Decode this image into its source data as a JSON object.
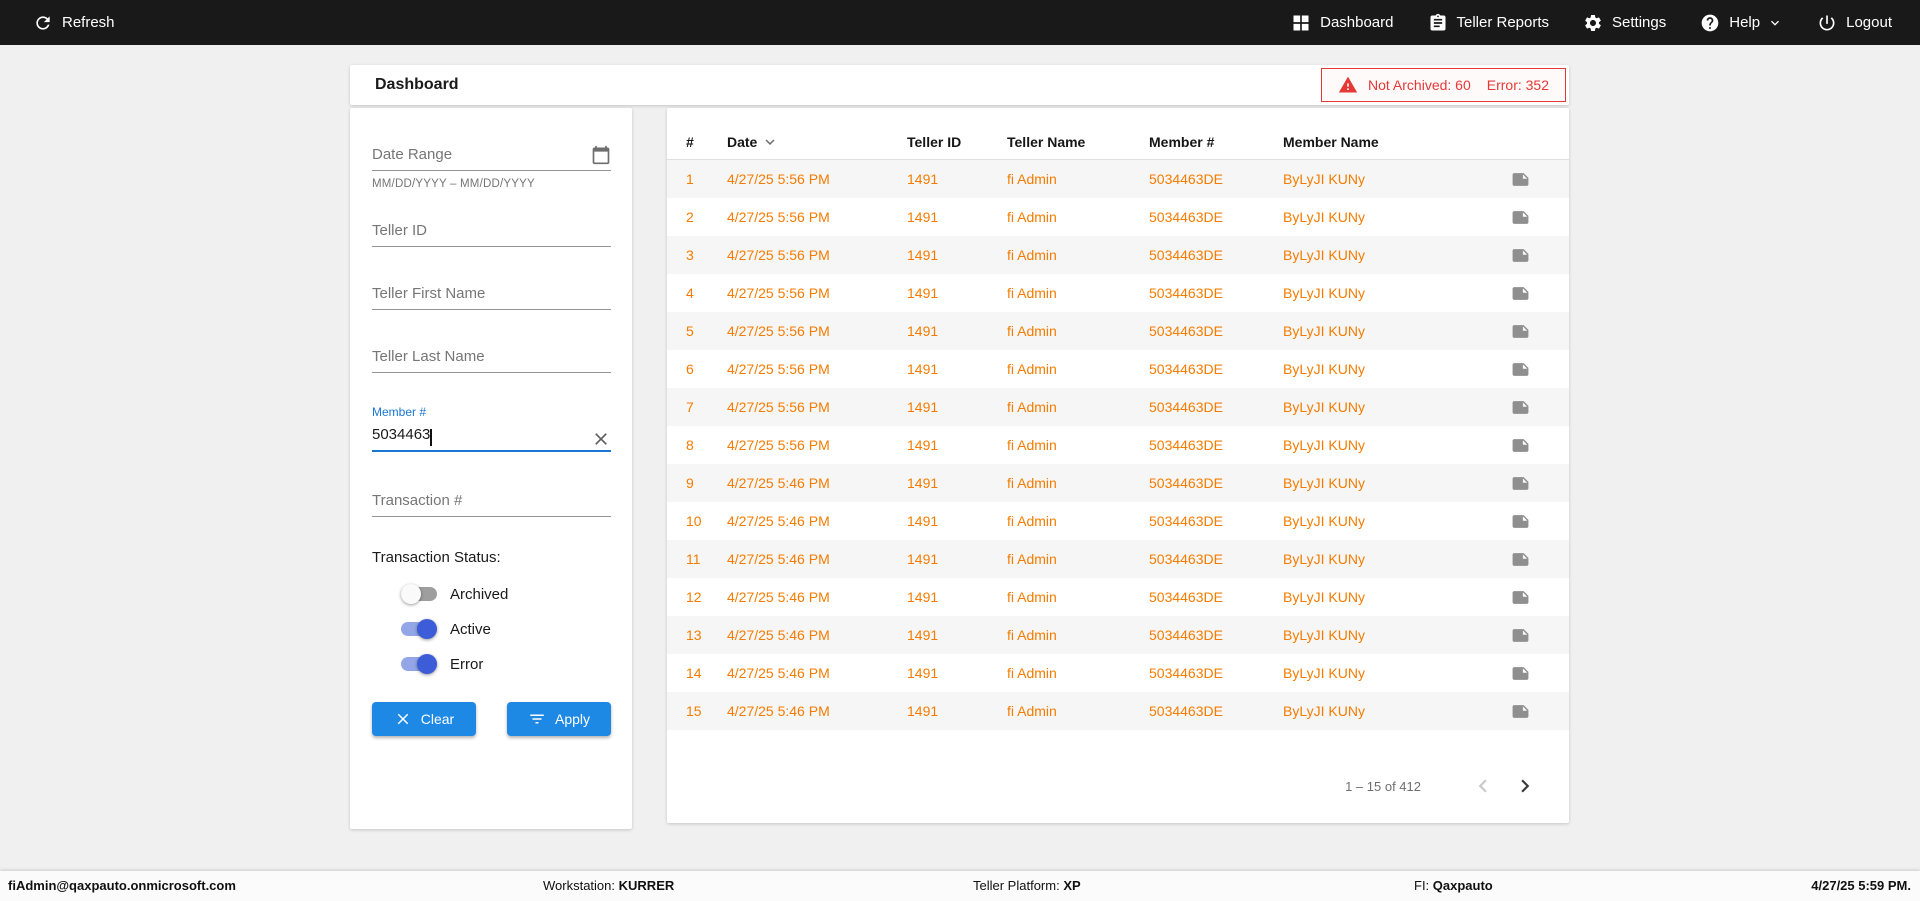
{
  "colors": {
    "accent_blue": "#1e88e5",
    "focus_blue": "#1976d2",
    "toggle_blue": "#3d5cd8",
    "row_orange": "#f57c00",
    "alert_red": "#e53935",
    "navbar_black": "#191919"
  },
  "navbar": {
    "refresh_label": "Refresh",
    "items": [
      {
        "label": "Dashboard",
        "icon": "dashboard-icon"
      },
      {
        "label": "Teller Reports",
        "icon": "reports-icon"
      },
      {
        "label": "Settings",
        "icon": "settings-icon"
      },
      {
        "label": "Help",
        "icon": "help-icon"
      },
      {
        "label": "Logout",
        "icon": "logout-icon"
      }
    ]
  },
  "header": {
    "title": "Dashboard",
    "alert": {
      "not_archived": "Not Archived: 60",
      "error": "Error: 352"
    }
  },
  "filters": {
    "date_range": {
      "placeholder": "Date Range",
      "hint": "MM/DD/YYYY – MM/DD/YYYY"
    },
    "teller_id_placeholder": "Teller ID",
    "teller_first_name_placeholder": "Teller First Name",
    "teller_last_name_placeholder": "Teller Last Name",
    "member_number": {
      "label": "Member #",
      "value": "5034463"
    },
    "transaction_number_placeholder": "Transaction #",
    "status_label": "Transaction Status:",
    "toggles": [
      {
        "label": "Archived",
        "on": false
      },
      {
        "label": "Active",
        "on": true
      },
      {
        "label": "Error",
        "on": true
      }
    ],
    "clear_label": "Clear",
    "apply_label": "Apply"
  },
  "table": {
    "columns": [
      "#",
      "Date",
      "Teller ID",
      "Teller Name",
      "Member #",
      "Member Name"
    ],
    "sorted_by": "Date",
    "rows": [
      {
        "num": "1",
        "date": "4/27/25 5:56 PM",
        "teller_id": "1491",
        "teller_name": "fi Admin",
        "member_number": "5034463DE",
        "member_name": "ByLyJI KUNy"
      },
      {
        "num": "2",
        "date": "4/27/25 5:56 PM",
        "teller_id": "1491",
        "teller_name": "fi Admin",
        "member_number": "5034463DE",
        "member_name": "ByLyJI KUNy"
      },
      {
        "num": "3",
        "date": "4/27/25 5:56 PM",
        "teller_id": "1491",
        "teller_name": "fi Admin",
        "member_number": "5034463DE",
        "member_name": "ByLyJI KUNy"
      },
      {
        "num": "4",
        "date": "4/27/25 5:56 PM",
        "teller_id": "1491",
        "teller_name": "fi Admin",
        "member_number": "5034463DE",
        "member_name": "ByLyJI KUNy"
      },
      {
        "num": "5",
        "date": "4/27/25 5:56 PM",
        "teller_id": "1491",
        "teller_name": "fi Admin",
        "member_number": "5034463DE",
        "member_name": "ByLyJI KUNy"
      },
      {
        "num": "6",
        "date": "4/27/25 5:56 PM",
        "teller_id": "1491",
        "teller_name": "fi Admin",
        "member_number": "5034463DE",
        "member_name": "ByLyJI KUNy"
      },
      {
        "num": "7",
        "date": "4/27/25 5:56 PM",
        "teller_id": "1491",
        "teller_name": "fi Admin",
        "member_number": "5034463DE",
        "member_name": "ByLyJI KUNy"
      },
      {
        "num": "8",
        "date": "4/27/25 5:56 PM",
        "teller_id": "1491",
        "teller_name": "fi Admin",
        "member_number": "5034463DE",
        "member_name": "ByLyJI KUNy"
      },
      {
        "num": "9",
        "date": "4/27/25 5:46 PM",
        "teller_id": "1491",
        "teller_name": "fi Admin",
        "member_number": "5034463DE",
        "member_name": "ByLyJI KUNy"
      },
      {
        "num": "10",
        "date": "4/27/25 5:46 PM",
        "teller_id": "1491",
        "teller_name": "fi Admin",
        "member_number": "5034463DE",
        "member_name": "ByLyJI KUNy"
      },
      {
        "num": "11",
        "date": "4/27/25 5:46 PM",
        "teller_id": "1491",
        "teller_name": "fi Admin",
        "member_number": "5034463DE",
        "member_name": "ByLyJI KUNy"
      },
      {
        "num": "12",
        "date": "4/27/25 5:46 PM",
        "teller_id": "1491",
        "teller_name": "fi Admin",
        "member_number": "5034463DE",
        "member_name": "ByLyJI KUNy"
      },
      {
        "num": "13",
        "date": "4/27/25 5:46 PM",
        "teller_id": "1491",
        "teller_name": "fi Admin",
        "member_number": "5034463DE",
        "member_name": "ByLyJI KUNy"
      },
      {
        "num": "14",
        "date": "4/27/25 5:46 PM",
        "teller_id": "1491",
        "teller_name": "fi Admin",
        "member_number": "5034463DE",
        "member_name": "ByLyJI KUNy"
      },
      {
        "num": "15",
        "date": "4/27/25 5:46 PM",
        "teller_id": "1491",
        "teller_name": "fi Admin",
        "member_number": "5034463DE",
        "member_name": "ByLyJI KUNy"
      }
    ],
    "pagination": {
      "range_label": "1 – 15 of 412"
    }
  },
  "footer": {
    "user": "fiAdmin@qaxpauto.onmicrosoft.com",
    "workstation_label": "Workstation:",
    "workstation_value": "KURRER",
    "platform_label": "Teller Platform:",
    "platform_value": "XP",
    "fi_label": "FI:",
    "fi_value": "Qaxpauto",
    "datetime": "4/27/25 5:59 PM."
  }
}
